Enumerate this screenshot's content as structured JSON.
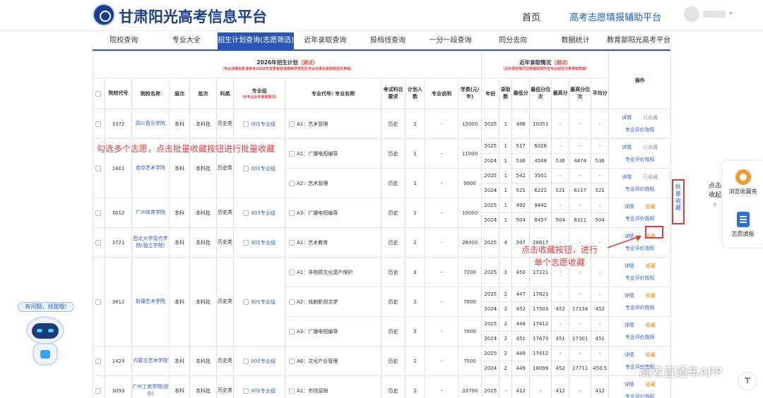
{
  "header": {
    "site_title": "甘肃阳光高考信息平台",
    "nav_home": "首页",
    "nav_assist": "高考志愿填报辅助平台"
  },
  "tabs": [
    "院校查询",
    "专业大全",
    "招生计划查询(志愿筛选)",
    "近年录取查询",
    "投档线查询",
    "一分一段查询",
    "同分去向",
    "数据统计",
    "教育部阳光高考平台"
  ],
  "active_tab": 2,
  "table": {
    "plan_title": "2026年招生计划",
    "plan_title_note": "（测试）",
    "plan_subnote": "（专业详细信息请参考2026年甘肃省普通高等学校招生专业目录及各院校招生章程）",
    "history_title": "近年录取情况",
    "history_title_note": "（测试）",
    "history_subnote": "（近年录取情况仅根据院校所在专业组位次等录取数据）",
    "actions_header": "操作",
    "columns": {
      "school_code": "院校代号",
      "school_name": "院校名称",
      "level": "层次",
      "batch": "批次",
      "subject": "科类",
      "group": "专业组",
      "group_note": "（含专业近年录取情况）",
      "major": "专业代号: 专业名称",
      "exam": "考试科目要求",
      "plan_count": "计划人数",
      "desc": "专业说明",
      "fee": "学费(元/年)",
      "year": "年份",
      "admit": "录取数",
      "min_score": "最低分",
      "min_rank": "最低分位次",
      "max_score": "最高分",
      "max_rank": "最高分位次",
      "avg_score": "平均分"
    },
    "action_labels": {
      "detail": "详情",
      "collected": "已收藏",
      "collect": "收藏",
      "eval": "专业评价指标"
    },
    "rows": [
      {
        "code": "3372",
        "school": "四川音乐学院",
        "level": "本科",
        "batch": "本科批",
        "subject": "历史类",
        "group": "001专业组",
        "majors": [
          {
            "major": "A1：艺术管理",
            "exam": "历史",
            "plan": "1",
            "desc": "-",
            "fee": "12000",
            "years": [
              {
                "y": "2025",
                "n": "1",
                "min": "488",
                "rank": "10051",
                "max": "-",
                "maxr": "-",
                "avg": "-"
              }
            ],
            "status": "collected"
          }
        ]
      },
      {
        "code": "1801",
        "school": "南京艺术学院",
        "level": "本科",
        "batch": "本科批",
        "subject": "历史类",
        "group": "001专业组",
        "majors": [
          {
            "major": "A1：广播电视编导",
            "exam": "历史",
            "plan": "1",
            "desc": "-",
            "fee": "11000",
            "years": [
              {
                "y": "2025",
                "n": "1",
                "min": "517",
                "rank": "6026",
                "max": "-",
                "maxr": "-",
                "avg": "-"
              },
              {
                "y": "2024",
                "n": "1",
                "min": "536",
                "rank": "4548",
                "max": "536",
                "maxr": "4474",
                "avg": "536"
              }
            ],
            "status": "collected"
          },
          {
            "major": "A2：艺术管理",
            "exam": "历史",
            "plan": "1",
            "desc": "-",
            "fee": "9900",
            "years": [
              {
                "y": "2025",
                "n": "1",
                "min": "542",
                "rank": "3501",
                "max": "-",
                "maxr": "-",
                "avg": "-"
              },
              {
                "y": "2024",
                "n": "1",
                "min": "521",
                "rank": "6222",
                "max": "521",
                "maxr": "6117",
                "avg": "521"
              }
            ],
            "status": "collected"
          }
        ]
      },
      {
        "code": "3012",
        "school": "广州体育学院",
        "level": "本科",
        "batch": "本科批",
        "subject": "历史类",
        "group": "003专业组",
        "majors": [
          {
            "major": "A3：广播电视编导",
            "exam": "历史",
            "plan": "1",
            "desc": "-",
            "fee": "10000",
            "years": [
              {
                "y": "2025",
                "n": "1",
                "min": "492",
                "rank": "9442",
                "max": "-",
                "maxr": "-",
                "avg": "-"
              },
              {
                "y": "2024",
                "n": "1",
                "min": "504",
                "rank": "8457",
                "max": "504",
                "maxr": "8311",
                "avg": "504"
              }
            ],
            "status": "collect"
          }
        ]
      },
      {
        "code": "3721",
        "school": "西北大学现代学院(独立学院)",
        "level": "本科",
        "batch": "本科批",
        "subject": "历史类",
        "group": "001专业组",
        "majors": [
          {
            "major": "A1：艺术教育",
            "exam": "历史",
            "plan": "2",
            "desc": "-",
            "fee": "28000",
            "years": [
              {
                "y": "2025",
                "n": "4",
                "min": "397",
                "rank": "28617",
                "max": "-",
                "maxr": "-",
                "avg": "-"
              }
            ],
            "status": "collect"
          }
        ]
      },
      {
        "code": "3812",
        "school": "新疆艺术学院",
        "level": "本科",
        "batch": "本科批",
        "subject": "历史类",
        "group": "001专业组",
        "majors": [
          {
            "major": "A1：非物质文化遗产保护",
            "exam": "历史",
            "plan": "3",
            "desc": "-",
            "fee": "7200",
            "years": [
              {
                "y": "2025",
                "n": "3",
                "min": "450",
                "rank": "17221",
                "max": "-",
                "maxr": "-",
                "avg": "-"
              }
            ],
            "status": "collect"
          },
          {
            "major": "A2：戏剧影视文学",
            "exam": "历史",
            "plan": "2",
            "desc": "-",
            "fee": "7800",
            "years": [
              {
                "y": "2025",
                "n": "2",
                "min": "447",
                "rank": "17823",
                "max": "-",
                "maxr": "-",
                "avg": "-"
              },
              {
                "y": "2024",
                "n": "2",
                "min": "452",
                "rank": "17503",
                "max": "452",
                "maxr": "17134",
                "avg": "452"
              }
            ],
            "status": "collect"
          },
          {
            "major": "A3：广播电视编导",
            "exam": "历史",
            "plan": "2",
            "desc": "-",
            "fee": "7800",
            "years": [
              {
                "y": "2025",
                "n": "2",
                "min": "449",
                "rank": "17412",
                "max": "-",
                "maxr": "-",
                "avg": "-"
              },
              {
                "y": "2024",
                "n": "2",
                "min": "451",
                "rank": "17673",
                "max": "451",
                "maxr": "17301",
                "avg": "451"
              }
            ],
            "status": "collect"
          }
        ]
      },
      {
        "code": "1424",
        "school": "内蒙古艺术学院",
        "level": "本科",
        "batch": "本科批",
        "subject": "历史类",
        "group": "003专业组",
        "majors": [
          {
            "major": "A6：文化产业管理",
            "exam": "历史",
            "plan": "2",
            "desc": "-",
            "fee": "7500",
            "years": [
              {
                "y": "2025",
                "n": "2",
                "min": "449",
                "rank": "17412",
                "max": "-",
                "maxr": "-",
                "avg": "-"
              },
              {
                "y": "2024",
                "n": "2",
                "min": "449",
                "rank": "18099",
                "max": "452",
                "maxr": "17711",
                "avg": "450.5"
              }
            ],
            "status": "collect"
          }
        ]
      },
      {
        "code": "3093",
        "school": "广州工商学院(民办)",
        "level": "本科",
        "batch": "本科批",
        "subject": "历史类",
        "group": "001专业组",
        "majors": [
          {
            "major": "A1：市场营销",
            "exam": "历史",
            "plan": "2",
            "desc": "-",
            "fee": "33700",
            "years": [
              {
                "y": "2025",
                "n": "-",
                "min": "412",
                "rank": "-",
                "max": "412",
                "maxr": "-",
                "avg": "412"
              }
            ],
            "status": "collect"
          }
        ]
      }
    ]
  },
  "annotations": {
    "batch_tip": "勾选多个志愿，点击批量收藏按钮进行批量收藏",
    "single_tip_line1": "点击收藏按钮，进行",
    "single_tip_line2": "单个志愿收藏"
  },
  "side": {
    "batch_collect": "批量收藏",
    "collapse": "点击收起",
    "favorites": "浏览收藏夹",
    "fill": "志愿填报"
  },
  "help_bubble": "有问题，找我哦!",
  "watermark": "高考直通车APP",
  "colors": {
    "primary": "#2a56b8",
    "link": "#2a5fd0",
    "accent_red": "#e84444",
    "collect_orange": "#f08a00"
  }
}
